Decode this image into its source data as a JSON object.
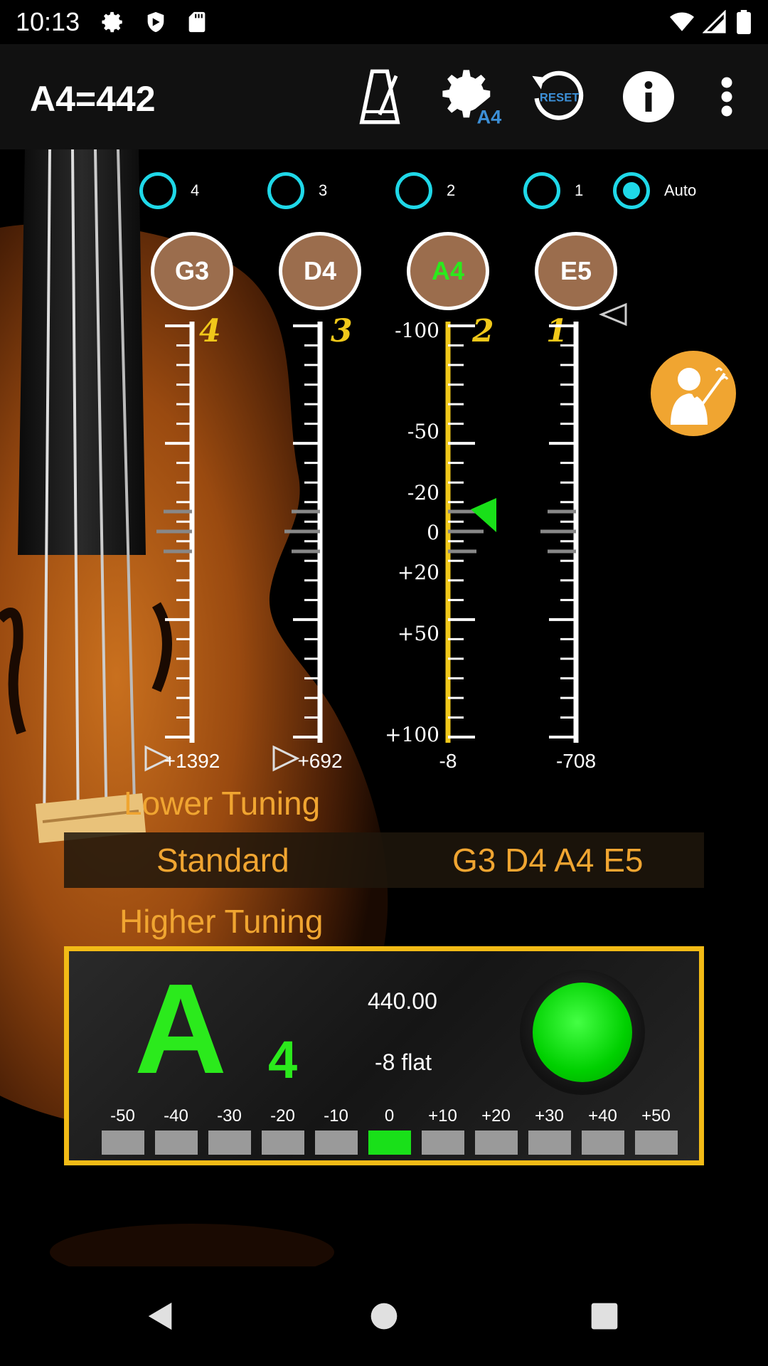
{
  "status": {
    "time": "10:13",
    "icons": [
      "gear-icon",
      "shield-icon",
      "sd-card-icon",
      "wifi-icon",
      "signal-icon",
      "battery-icon"
    ]
  },
  "appbar": {
    "title": "A4=442",
    "actions": [
      "metronome-icon",
      "settings-a4-icon",
      "reset-icon",
      "info-icon",
      "more-vert-icon"
    ],
    "settings_badge": "A4",
    "reset_label": "RESET"
  },
  "strings": {
    "options": [
      {
        "label": "4",
        "selected": false
      },
      {
        "label": "3",
        "selected": false
      },
      {
        "label": "2",
        "selected": false
      },
      {
        "label": "1",
        "selected": false
      },
      {
        "label": "Auto",
        "selected": true
      }
    ],
    "notes": [
      {
        "note": "G3",
        "number": "4",
        "cents": "+1392",
        "active": false
      },
      {
        "note": "D4",
        "number": "3",
        "cents": "+692",
        "active": false
      },
      {
        "note": "A4",
        "number": "2",
        "cents": "-8",
        "active": true
      },
      {
        "note": "E5",
        "number": "1",
        "cents": "-708",
        "active": false
      }
    ],
    "scale_labels": [
      "-100",
      "-50",
      "-20",
      "0",
      "+20",
      "+50",
      "+100"
    ]
  },
  "tuning": {
    "lower_label": "Lower Tuning",
    "current_name": "Standard",
    "current_notes": "G3 D4 A4 E5",
    "higher_label": "Higher Tuning"
  },
  "tuner": {
    "note": "A",
    "octave": "4",
    "frequency": "440.00",
    "deviation": "-8 flat",
    "meter_labels": [
      "-50",
      "-40",
      "-30",
      "-20",
      "-10",
      "0",
      "+10",
      "+20",
      "+30",
      "+40",
      "+50"
    ],
    "meter_active_index": 5,
    "colors": {
      "accent": "#2bea1c",
      "border": "#f2bb16",
      "tuning_text": "#f0a531"
    }
  }
}
